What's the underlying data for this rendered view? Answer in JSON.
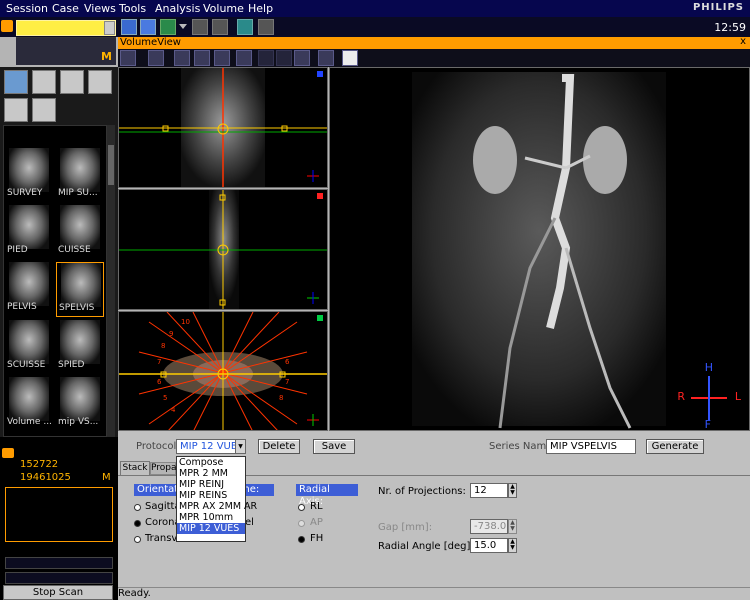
{
  "menubar": {
    "items": [
      "Session",
      "Case",
      "Views",
      "Tools",
      "Analysis",
      "Volume",
      "Help"
    ],
    "brand": "PHILIPS"
  },
  "toolbar_top": {
    "clock": "12:59",
    "patient_sex_short": "M"
  },
  "volume_view": {
    "tab_label": "VolumeView",
    "close_glyph": "x"
  },
  "thumbnails": [
    {
      "label": "SURVEY"
    },
    {
      "label": "MIP SU..."
    },
    {
      "label": "PIED"
    },
    {
      "label": "CUISSE"
    },
    {
      "label": "PELVIS"
    },
    {
      "label": "SPELVIS"
    },
    {
      "label": "SCUISSE"
    },
    {
      "label": "SPIED"
    },
    {
      "label": "Volume ..."
    },
    {
      "label": "mip VS..."
    }
  ],
  "patient_info": {
    "id": "152722",
    "dob": "19461025",
    "sex": "M"
  },
  "stop_scan": "Stop Scan",
  "views": {
    "orientation_labels": {
      "h": "H",
      "r": "R",
      "l": "L",
      "f": "F"
    },
    "clock_numbers": [
      "10",
      "9",
      "8",
      "7",
      "6",
      "5",
      "4",
      "6",
      "7",
      "8"
    ]
  },
  "protocol_panel": {
    "protocol_label": "Protocol:",
    "protocol_value": "MIP 12 VUES",
    "delete_btn": "Delete",
    "save_btn": "Save",
    "series_name_label": "Series Name:",
    "series_name_value": "MIP VSPELVIS",
    "generate_btn": "Generate",
    "tabs": [
      "Stack",
      "Propa"
    ],
    "orientation_header": "Orientation",
    "orientation_tail": "me:",
    "orientation_tail2": "el",
    "orientation_options": [
      "Sagittal",
      "Coronal",
      "Transve"
    ],
    "radial_axis_header": "Radial Axis:",
    "radial_axis_options": [
      "RL",
      "AP",
      "FH"
    ],
    "projections_label": "Nr. of Projections:",
    "projections_value": "12",
    "gap_label": "Gap [mm]:",
    "gap_value": "-738.0",
    "radial_angle_label": "Radial Angle [deg]:",
    "radial_angle_value": "15.0",
    "dropdown_options": [
      "Compose",
      "MPR 2 MM",
      "MIP REINJ",
      "MIP REINS",
      "MPR AX 2MM AR",
      "MPR 10mm",
      "MIP 12 VUES"
    ]
  },
  "status": {
    "text": "Ready."
  }
}
